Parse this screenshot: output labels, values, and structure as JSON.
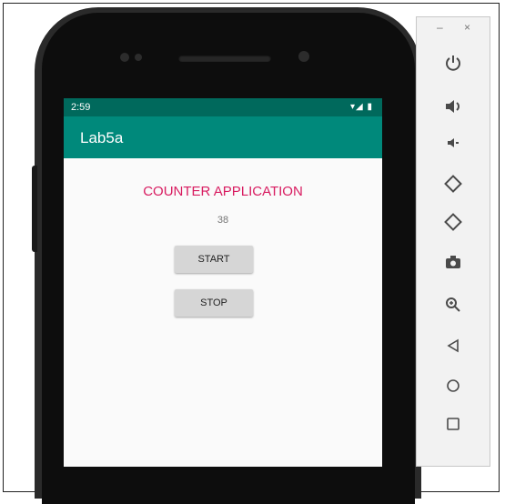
{
  "device": {
    "status_time": "2:59",
    "status_icons": "▾◢ ▮"
  },
  "app": {
    "title": "Lab5a",
    "heading": "COUNTER APPLICATION",
    "counter_value": "38",
    "start_label": "START",
    "stop_label": "STOP",
    "colors": {
      "status_bar": "#00695c",
      "app_bar": "#00897b",
      "heading_text": "#d81b60",
      "button_bg": "#d6d6d6"
    }
  },
  "emulator_toolbar": {
    "minimize": "–",
    "close": "×",
    "icons": [
      {
        "name": "power-icon",
        "glyph": "⏻"
      },
      {
        "name": "volume-up-icon",
        "glyph": "🔊"
      },
      {
        "name": "volume-down-icon",
        "glyph": "🔉"
      },
      {
        "name": "rotate-left-icon",
        "glyph": "⟲"
      },
      {
        "name": "rotate-right-icon",
        "glyph": "⟳"
      },
      {
        "name": "camera-icon",
        "glyph": "📷"
      },
      {
        "name": "zoom-icon",
        "glyph": "⊕"
      },
      {
        "name": "back-icon",
        "glyph": "◁"
      },
      {
        "name": "home-icon",
        "glyph": "○"
      },
      {
        "name": "overview-icon",
        "glyph": "□"
      }
    ]
  }
}
